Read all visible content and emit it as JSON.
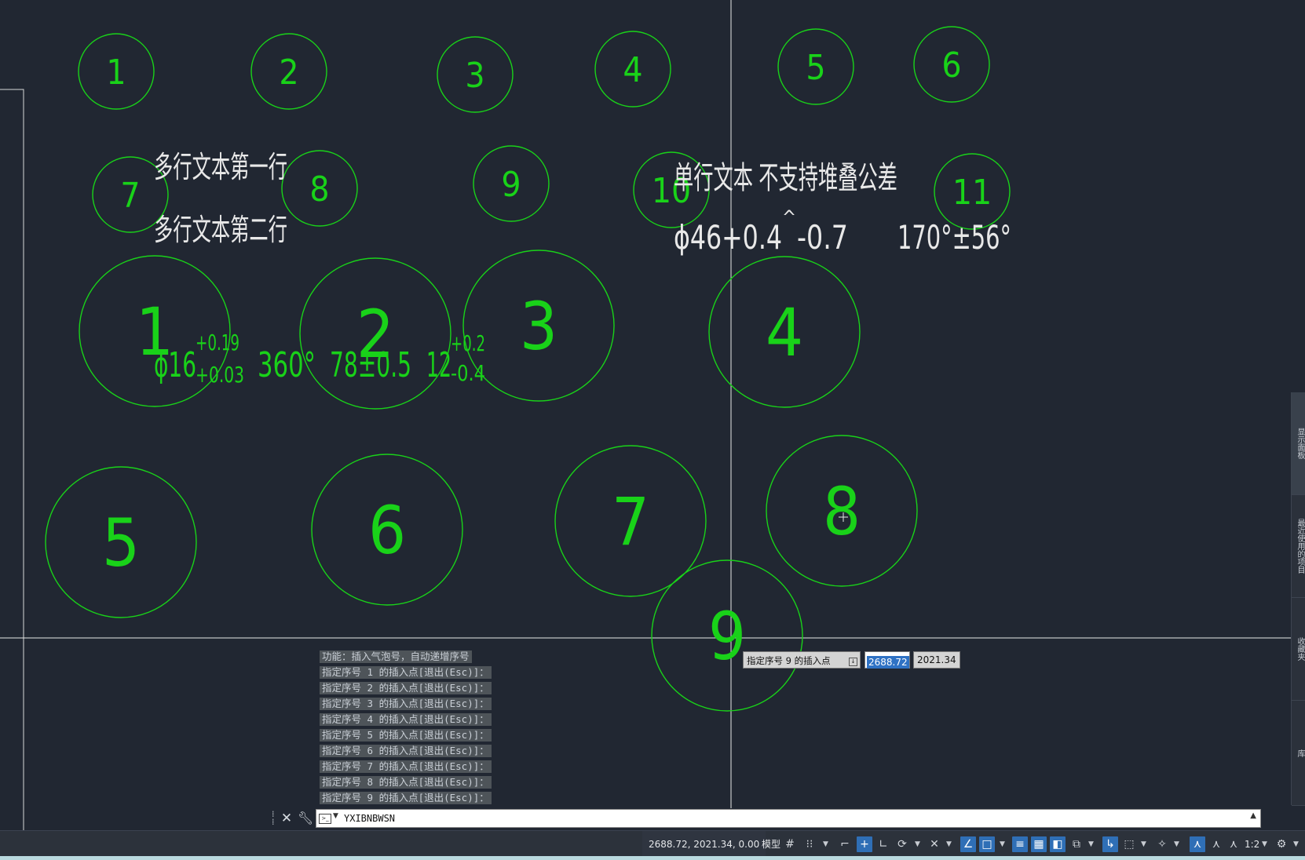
{
  "drawing": {
    "small_bubbles": [
      "1",
      "2",
      "3",
      "4",
      "5",
      "6",
      "7",
      "8",
      "9",
      "10",
      "11"
    ],
    "large_bubbles": [
      "1",
      "2",
      "3",
      "4",
      "5",
      "6",
      "7",
      "8",
      "9"
    ],
    "mtext_line1": "多行文本第一行",
    "mtext_line2": "多行文本第二行",
    "single_line_text": "单行文本 不支持堆叠公差",
    "single_line_tol_a_main": "ϕ46+0.4",
    "single_line_tol_a_caret": "^",
    "single_line_tol_a_rest": "-0.7",
    "single_line_tol_b": "170°±56°",
    "stack_dia": "ϕ16",
    "stack_dia_upper": "+0.19",
    "stack_dia_lower": "+0.03",
    "angle_text": "360°",
    "sym_tol_text": "78±0.5",
    "stack2_base": "12",
    "stack2_upper": "+0.2",
    "stack2_lower": "-0.4"
  },
  "command_history": [
    "功能：插入气泡号，自动递增序号",
    "指定序号 1 的插入点[退出(Esc)]：",
    "指定序号 2 的插入点[退出(Esc)]：",
    "指定序号 3 的插入点[退出(Esc)]：",
    "指定序号 4 的插入点[退出(Esc)]：",
    "指定序号 5 的插入点[退出(Esc)]：",
    "指定序号 6 的插入点[退出(Esc)]：",
    "指定序号 7 的插入点[退出(Esc)]：",
    "指定序号 8 的插入点[退出(Esc)]：",
    "指定序号 9 的插入点[退出(Esc)]："
  ],
  "dynamic_input": {
    "prompt": "指定序号 9 的插入点",
    "x_value": "2688.72",
    "y_value": "2021.34"
  },
  "command_line": {
    "current_command": "YXIBNBWSN"
  },
  "status_bar": {
    "coordinates": "2688.72, 2021.34, 0.00",
    "model_label": "模型",
    "annotation_scale": "1:2"
  },
  "palette_tabs": [
    "显示面板",
    "最近使用的项目",
    "收藏夹",
    "库"
  ],
  "colors": {
    "background": "#212732",
    "entity_green": "#19d219",
    "text_white": "#e8e8e8",
    "crosshair": "#ffffff"
  }
}
